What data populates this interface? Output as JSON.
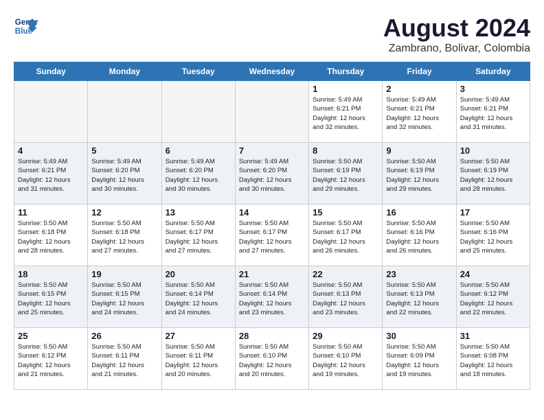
{
  "header": {
    "logo_line1": "General",
    "logo_line2": "Blue",
    "title": "August 2024",
    "subtitle": "Zambrano, Bolivar, Colombia"
  },
  "days_of_week": [
    "Sunday",
    "Monday",
    "Tuesday",
    "Wednesday",
    "Thursday",
    "Friday",
    "Saturday"
  ],
  "weeks": [
    [
      {
        "num": "",
        "info": "",
        "empty": true
      },
      {
        "num": "",
        "info": "",
        "empty": true
      },
      {
        "num": "",
        "info": "",
        "empty": true
      },
      {
        "num": "",
        "info": "",
        "empty": true
      },
      {
        "num": "1",
        "info": "Sunrise: 5:49 AM\nSunset: 6:21 PM\nDaylight: 12 hours\nand 32 minutes.",
        "empty": false
      },
      {
        "num": "2",
        "info": "Sunrise: 5:49 AM\nSunset: 6:21 PM\nDaylight: 12 hours\nand 32 minutes.",
        "empty": false
      },
      {
        "num": "3",
        "info": "Sunrise: 5:49 AM\nSunset: 6:21 PM\nDaylight: 12 hours\nand 31 minutes.",
        "empty": false
      }
    ],
    [
      {
        "num": "4",
        "info": "Sunrise: 5:49 AM\nSunset: 6:21 PM\nDaylight: 12 hours\nand 31 minutes.",
        "empty": false
      },
      {
        "num": "5",
        "info": "Sunrise: 5:49 AM\nSunset: 6:20 PM\nDaylight: 12 hours\nand 30 minutes.",
        "empty": false
      },
      {
        "num": "6",
        "info": "Sunrise: 5:49 AM\nSunset: 6:20 PM\nDaylight: 12 hours\nand 30 minutes.",
        "empty": false
      },
      {
        "num": "7",
        "info": "Sunrise: 5:49 AM\nSunset: 6:20 PM\nDaylight: 12 hours\nand 30 minutes.",
        "empty": false
      },
      {
        "num": "8",
        "info": "Sunrise: 5:50 AM\nSunset: 6:19 PM\nDaylight: 12 hours\nand 29 minutes.",
        "empty": false
      },
      {
        "num": "9",
        "info": "Sunrise: 5:50 AM\nSunset: 6:19 PM\nDaylight: 12 hours\nand 29 minutes.",
        "empty": false
      },
      {
        "num": "10",
        "info": "Sunrise: 5:50 AM\nSunset: 6:19 PM\nDaylight: 12 hours\nand 28 minutes.",
        "empty": false
      }
    ],
    [
      {
        "num": "11",
        "info": "Sunrise: 5:50 AM\nSunset: 6:18 PM\nDaylight: 12 hours\nand 28 minutes.",
        "empty": false
      },
      {
        "num": "12",
        "info": "Sunrise: 5:50 AM\nSunset: 6:18 PM\nDaylight: 12 hours\nand 27 minutes.",
        "empty": false
      },
      {
        "num": "13",
        "info": "Sunrise: 5:50 AM\nSunset: 6:17 PM\nDaylight: 12 hours\nand 27 minutes.",
        "empty": false
      },
      {
        "num": "14",
        "info": "Sunrise: 5:50 AM\nSunset: 6:17 PM\nDaylight: 12 hours\nand 27 minutes.",
        "empty": false
      },
      {
        "num": "15",
        "info": "Sunrise: 5:50 AM\nSunset: 6:17 PM\nDaylight: 12 hours\nand 26 minutes.",
        "empty": false
      },
      {
        "num": "16",
        "info": "Sunrise: 5:50 AM\nSunset: 6:16 PM\nDaylight: 12 hours\nand 26 minutes.",
        "empty": false
      },
      {
        "num": "17",
        "info": "Sunrise: 5:50 AM\nSunset: 6:16 PM\nDaylight: 12 hours\nand 25 minutes.",
        "empty": false
      }
    ],
    [
      {
        "num": "18",
        "info": "Sunrise: 5:50 AM\nSunset: 6:15 PM\nDaylight: 12 hours\nand 25 minutes.",
        "empty": false
      },
      {
        "num": "19",
        "info": "Sunrise: 5:50 AM\nSunset: 6:15 PM\nDaylight: 12 hours\nand 24 minutes.",
        "empty": false
      },
      {
        "num": "20",
        "info": "Sunrise: 5:50 AM\nSunset: 6:14 PM\nDaylight: 12 hours\nand 24 minutes.",
        "empty": false
      },
      {
        "num": "21",
        "info": "Sunrise: 5:50 AM\nSunset: 6:14 PM\nDaylight: 12 hours\nand 23 minutes.",
        "empty": false
      },
      {
        "num": "22",
        "info": "Sunrise: 5:50 AM\nSunset: 6:13 PM\nDaylight: 12 hours\nand 23 minutes.",
        "empty": false
      },
      {
        "num": "23",
        "info": "Sunrise: 5:50 AM\nSunset: 6:13 PM\nDaylight: 12 hours\nand 22 minutes.",
        "empty": false
      },
      {
        "num": "24",
        "info": "Sunrise: 5:50 AM\nSunset: 6:12 PM\nDaylight: 12 hours\nand 22 minutes.",
        "empty": false
      }
    ],
    [
      {
        "num": "25",
        "info": "Sunrise: 5:50 AM\nSunset: 6:12 PM\nDaylight: 12 hours\nand 21 minutes.",
        "empty": false
      },
      {
        "num": "26",
        "info": "Sunrise: 5:50 AM\nSunset: 6:11 PM\nDaylight: 12 hours\nand 21 minutes.",
        "empty": false
      },
      {
        "num": "27",
        "info": "Sunrise: 5:50 AM\nSunset: 6:11 PM\nDaylight: 12 hours\nand 20 minutes.",
        "empty": false
      },
      {
        "num": "28",
        "info": "Sunrise: 5:50 AM\nSunset: 6:10 PM\nDaylight: 12 hours\nand 20 minutes.",
        "empty": false
      },
      {
        "num": "29",
        "info": "Sunrise: 5:50 AM\nSunset: 6:10 PM\nDaylight: 12 hours\nand 19 minutes.",
        "empty": false
      },
      {
        "num": "30",
        "info": "Sunrise: 5:50 AM\nSunset: 6:09 PM\nDaylight: 12 hours\nand 19 minutes.",
        "empty": false
      },
      {
        "num": "31",
        "info": "Sunrise: 5:50 AM\nSunset: 6:08 PM\nDaylight: 12 hours\nand 18 minutes.",
        "empty": false
      }
    ]
  ]
}
